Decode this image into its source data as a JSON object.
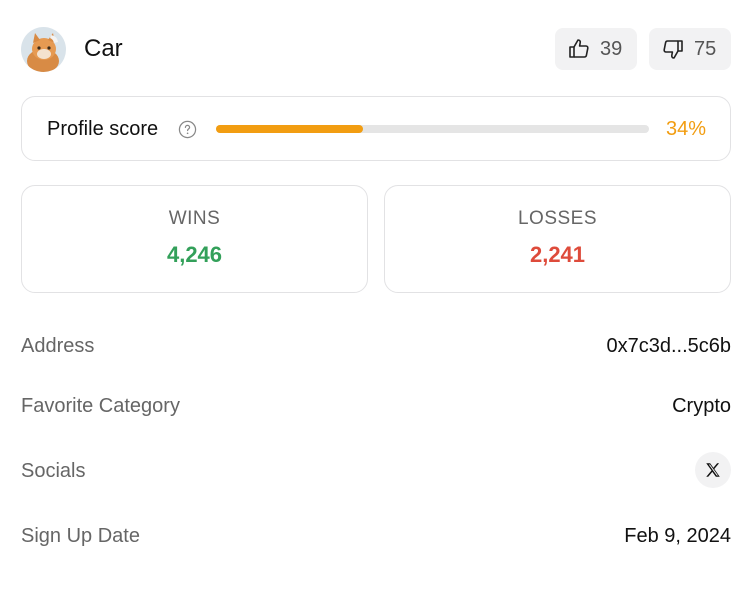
{
  "profile": {
    "name": "Car",
    "upvotes": "39",
    "downvotes": "75"
  },
  "score": {
    "label": "Profile score",
    "percent_text": "34%",
    "fraction": 0.34,
    "fill_color": "#f29d11"
  },
  "stats": {
    "wins_label": "WINS",
    "wins_value": "4,246",
    "wins_color": "#33a05a",
    "losses_label": "LOSSES",
    "losses_value": "2,241",
    "losses_color": "#de4b3b"
  },
  "details": {
    "address_label": "Address",
    "address_value": "0x7c3d...5c6b",
    "category_label": "Favorite Category",
    "category_value": "Crypto",
    "socials_label": "Socials",
    "socials_icon": "x-logo-icon",
    "signup_label": "Sign Up Date",
    "signup_value": "Feb 9, 2024"
  }
}
